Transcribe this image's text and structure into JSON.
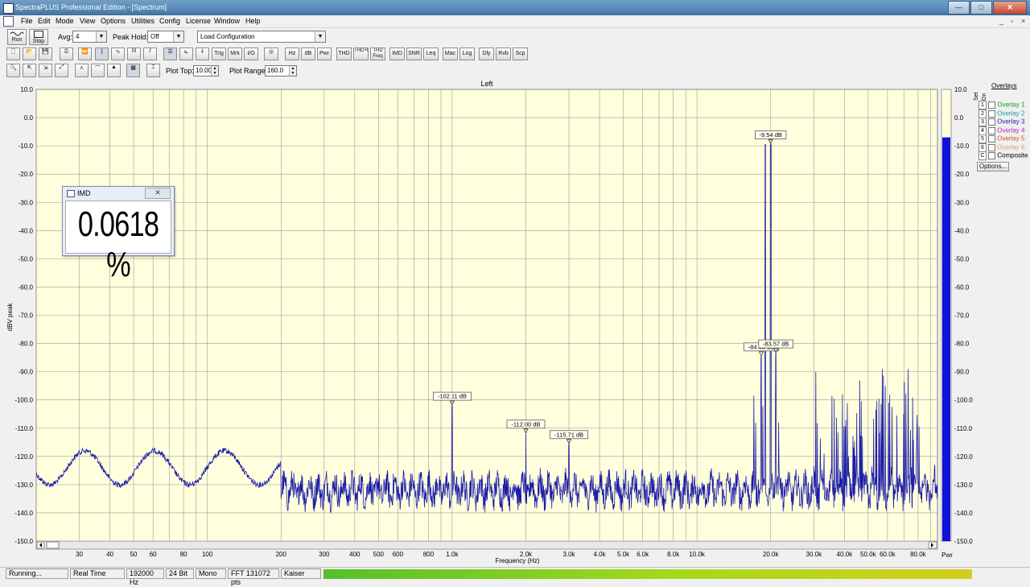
{
  "window": {
    "title": "SpectraPLUS Professional Edition - [Spectrum]"
  },
  "menu": [
    "File",
    "Edit",
    "Mode",
    "View",
    "Options",
    "Utilities",
    "Config",
    "License",
    "Window",
    "Help"
  ],
  "toolbar1": {
    "run": "Run",
    "stop": "Stop",
    "avg_label": "Avg:",
    "avg_value": "4",
    "peakhold_label": "Peak Hold:",
    "peakhold_value": "Off",
    "loadcfg_value": "Load Configuration"
  },
  "toolbar2": [
    "Trig",
    "Mrk",
    "I/O",
    "Hz",
    "dB",
    "Pwr",
    "THD",
    "THD+N",
    "THD Freq",
    "IMD",
    "SNR",
    "Leq",
    "Mac",
    "Log",
    "Dly",
    "Rvb",
    "Scp"
  ],
  "toolbar3": {
    "plot_top_label": "Plot Top:",
    "plot_top_value": "10.00",
    "plot_range_label": "Plot Range:",
    "plot_range_value": "160.0"
  },
  "plot": {
    "channel": "Left",
    "ylabel": "dBV peak",
    "xlabel": "Frequency (Hz)",
    "pwr_label": "Pwr",
    "yticks": [
      "10.0",
      "0.0",
      "-10.0",
      "-20.0",
      "-30.0",
      "-40.0",
      "-50.0",
      "-60.0",
      "-70.0",
      "-80.0",
      "-90.0",
      "-100.0",
      "-110.0",
      "-120.0",
      "-130.0",
      "-140.0",
      "-150.0"
    ],
    "xtick_labels": [
      "30",
      "40",
      "50",
      "60",
      "80",
      "100",
      "200",
      "300",
      "400",
      "500",
      "600",
      "800",
      "1.0k",
      "2.0k",
      "3.0k",
      "4.0k",
      "5.0k",
      "6.0k",
      "8.0k",
      "10.0k",
      "20.0k",
      "30.0k",
      "40.0k",
      "50.0k",
      "60.0k",
      "80.0k"
    ],
    "background": "#ffffdd",
    "trace_color": "#1c1ca8",
    "power_bar_level_db": -7
  },
  "chart_data": {
    "type": "line",
    "xscale": "log",
    "xlim": [
      20,
      96000
    ],
    "ylim": [
      -150,
      10
    ],
    "xlabel": "Frequency (Hz)",
    "ylabel": "dBV peak",
    "noise_floor_db": -132,
    "peaks": [
      {
        "f": 1000,
        "db": -102.11
      },
      {
        "f": 2000,
        "db": -112.0
      },
      {
        "f": 3000,
        "db": -115.71
      },
      {
        "f": 18300,
        "db": -84.65
      },
      {
        "f": 19000,
        "db": -9.5
      },
      {
        "f": 20000,
        "db": -9.54
      },
      {
        "f": 21000,
        "db": -83.57
      }
    ],
    "markers": [
      {
        "f": 1000,
        "db": -102.11,
        "label": "-102.11 dB"
      },
      {
        "f": 2000,
        "db": -112.0,
        "label": "-112.00 dB"
      },
      {
        "f": 3000,
        "db": -115.71,
        "label": "-115.71 dB"
      },
      {
        "f": 20000,
        "db": -9.54,
        "label": "-9.54 dB"
      },
      {
        "f": 18300,
        "db": -84.65,
        "label": "-84.65 dB"
      },
      {
        "f": 21000,
        "db": -83.57,
        "label": "-83.57 dB"
      }
    ]
  },
  "overlays": {
    "title": "Overlays",
    "set_label": "Set",
    "on_label": "On",
    "items": [
      {
        "num": "1",
        "label": "Overlay 1",
        "color": "#18a018"
      },
      {
        "num": "2",
        "label": "Overlay 2",
        "color": "#18a0a0"
      },
      {
        "num": "3",
        "label": "Overlay 3",
        "color": "#2020c0"
      },
      {
        "num": "4",
        "label": "Overlay 4",
        "color": "#c020c0"
      },
      {
        "num": "5",
        "label": "Overlay 5",
        "color": "#c06020"
      },
      {
        "num": "6",
        "label": "Overlay 6",
        "color": "#e0a070"
      },
      {
        "num": "C",
        "label": "Composite",
        "color": "#000000"
      }
    ],
    "options_button": "Options..."
  },
  "imd_window": {
    "title": "IMD",
    "value": "0.0618 %"
  },
  "status": {
    "state": "Running...",
    "mode": "Real Time",
    "rate": "192000 Hz",
    "bits": "24 Bit",
    "channels": "Mono",
    "fft": "FFT 131072 pts",
    "window": "Kaiser"
  }
}
